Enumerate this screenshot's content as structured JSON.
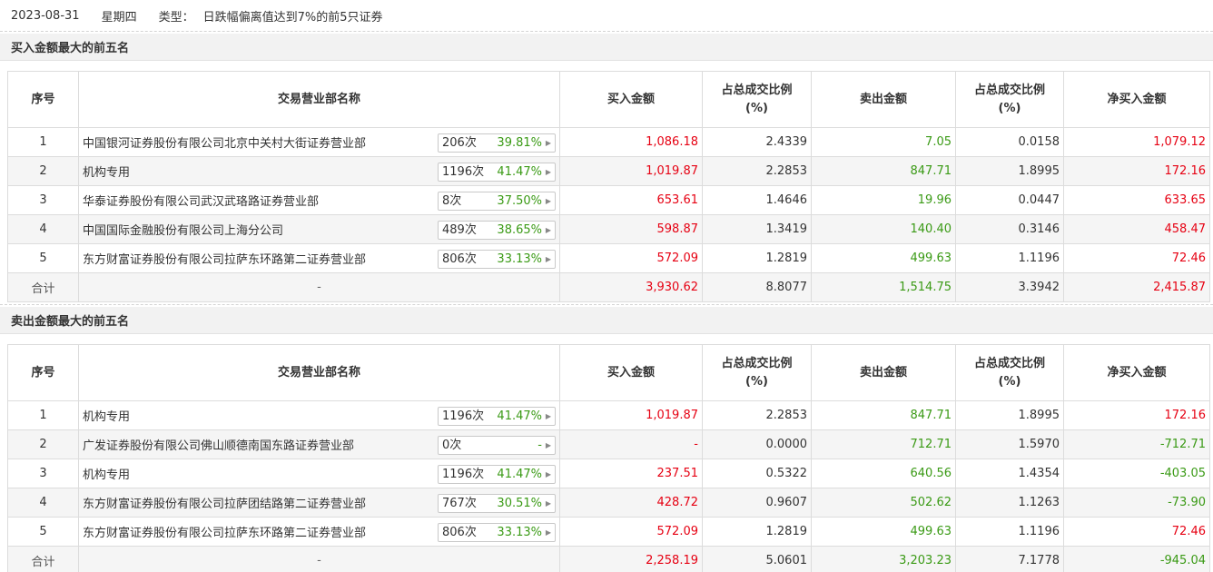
{
  "header": {
    "date": "2023-08-31",
    "weekday": "星期四",
    "type_label": "类型：",
    "type_value": "日跌幅偏离值达到7%的前5只证券"
  },
  "columns": {
    "idx": "序号",
    "name": "交易营业部名称",
    "buy": "买入金额",
    "buy_ratio_l1": "占总成交比例",
    "buy_ratio_l2": "(%)",
    "sell": "卖出金额",
    "sell_ratio_l1": "占总成交比例",
    "sell_ratio_l2": "(%)",
    "net": "净买入金额"
  },
  "buy_section": {
    "title": "买入金额最大的前五名",
    "rows": [
      {
        "idx": "1",
        "name": "中国银河证券股份有限公司北京中关村大街证券营业部",
        "count": "206次",
        "pct": "39.81%",
        "arrow": "▶",
        "buy": "1,086.18",
        "buy_ratio": "2.4339",
        "sell": "7.05",
        "sell_ratio": "0.0158",
        "net": "1,079.12",
        "net_color": "red"
      },
      {
        "idx": "2",
        "name": "机构专用",
        "count": "1196次",
        "pct": "41.47%",
        "arrow": "▶",
        "buy": "1,019.87",
        "buy_ratio": "2.2853",
        "sell": "847.71",
        "sell_ratio": "1.8995",
        "net": "172.16",
        "net_color": "red"
      },
      {
        "idx": "3",
        "name": "华泰证券股份有限公司武汉武珞路证券营业部",
        "count": "8次",
        "pct": "37.50%",
        "arrow": "▶",
        "buy": "653.61",
        "buy_ratio": "1.4646",
        "sell": "19.96",
        "sell_ratio": "0.0447",
        "net": "633.65",
        "net_color": "red"
      },
      {
        "idx": "4",
        "name": "中国国际金融股份有限公司上海分公司",
        "count": "489次",
        "pct": "38.65%",
        "arrow": "▶",
        "buy": "598.87",
        "buy_ratio": "1.3419",
        "sell": "140.40",
        "sell_ratio": "0.3146",
        "net": "458.47",
        "net_color": "red"
      },
      {
        "idx": "5",
        "name": "东方财富证券股份有限公司拉萨东环路第二证券营业部",
        "count": "806次",
        "pct": "33.13%",
        "arrow": "▶",
        "buy": "572.09",
        "buy_ratio": "1.2819",
        "sell": "499.63",
        "sell_ratio": "1.1196",
        "net": "72.46",
        "net_color": "red"
      }
    ],
    "total": {
      "label": "合计",
      "name": "-",
      "buy": "3,930.62",
      "buy_ratio": "8.8077",
      "sell": "1,514.75",
      "sell_ratio": "3.3942",
      "net": "2,415.87",
      "net_color": "red"
    }
  },
  "sell_section": {
    "title": "卖出金额最大的前五名",
    "rows": [
      {
        "idx": "1",
        "name": "机构专用",
        "count": "1196次",
        "pct": "41.47%",
        "arrow": "▶",
        "buy": "1,019.87",
        "buy_ratio": "2.2853",
        "sell": "847.71",
        "sell_ratio": "1.8995",
        "net": "172.16",
        "net_color": "red"
      },
      {
        "idx": "2",
        "name": "广发证券股份有限公司佛山顺德南国东路证券营业部",
        "count": "0次",
        "pct": "-",
        "arrow": "▶",
        "buy": "-",
        "buy_ratio": "0.0000",
        "sell": "712.71",
        "sell_ratio": "1.5970",
        "net": "-712.71",
        "net_color": "green"
      },
      {
        "idx": "3",
        "name": "机构专用",
        "count": "1196次",
        "pct": "41.47%",
        "arrow": "▶",
        "buy": "237.51",
        "buy_ratio": "0.5322",
        "sell": "640.56",
        "sell_ratio": "1.4354",
        "net": "-403.05",
        "net_color": "green"
      },
      {
        "idx": "4",
        "name": "东方财富证券股份有限公司拉萨团结路第二证券营业部",
        "count": "767次",
        "pct": "30.51%",
        "arrow": "▶",
        "buy": "428.72",
        "buy_ratio": "0.9607",
        "sell": "502.62",
        "sell_ratio": "1.1263",
        "net": "-73.90",
        "net_color": "green"
      },
      {
        "idx": "5",
        "name": "东方财富证券股份有限公司拉萨东环路第二证券营业部",
        "count": "806次",
        "pct": "33.13%",
        "arrow": "▶",
        "buy": "572.09",
        "buy_ratio": "1.2819",
        "sell": "499.63",
        "sell_ratio": "1.1196",
        "net": "72.46",
        "net_color": "red"
      }
    ],
    "total": {
      "label": "合计",
      "name": "-",
      "buy": "2,258.19",
      "buy_ratio": "5.0601",
      "sell": "3,203.23",
      "sell_ratio": "7.1778",
      "net": "-945.04",
      "net_color": "green"
    }
  },
  "colors": {
    "red": "#e60012",
    "green": "#3a9a15",
    "header_bg": "#f2f2f2",
    "stripe": "#f5f5f5",
    "border": "#dcdcdc"
  },
  "icons": {
    "pill_arrow": "caret-right-icon"
  }
}
